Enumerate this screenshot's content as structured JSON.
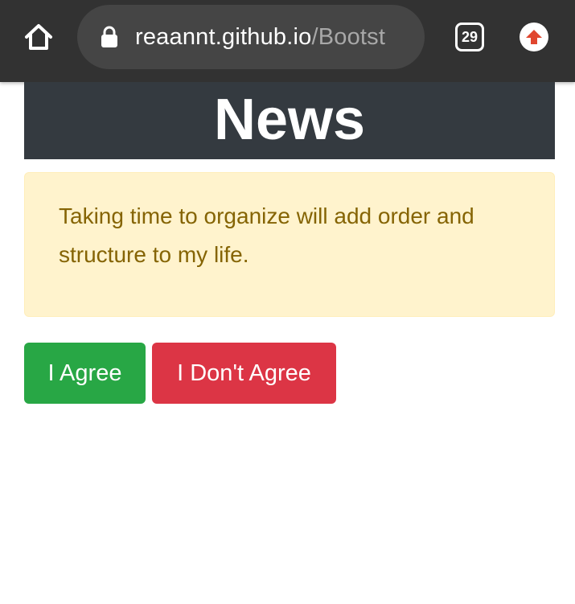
{
  "browser": {
    "url_domain": "reaannt.github.io",
    "url_path": "/Bootst",
    "tab_count": "29",
    "icons": {
      "home": "home-icon",
      "lock": "lock-icon",
      "update": "arrow-up-icon"
    },
    "colors": {
      "toolbar": "#323232",
      "url_pill": "#454545",
      "update_arrow": "#e0462f"
    }
  },
  "page": {
    "header_title": "News",
    "alert_text": "Taking time to organize will add order and structure to my life.",
    "buttons": {
      "agree_label": "I Agree",
      "disagree_label": "I Don't Agree"
    },
    "colors": {
      "header_bg": "#343a40",
      "alert_bg": "#fff3cd",
      "alert_text": "#856404",
      "agree": "#28a745",
      "disagree": "#dc3545"
    }
  }
}
